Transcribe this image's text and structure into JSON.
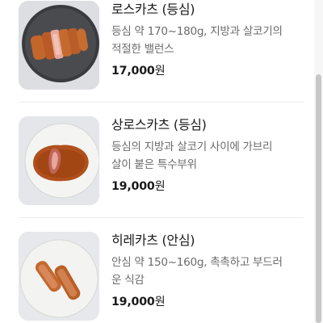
{
  "menu": {
    "items": [
      {
        "name": "로스카츠 (등심)",
        "description_line1": "등심 약 170~180g, 지방과 살코기의",
        "description_line2": "적절한 밸런스",
        "price": "17,000",
        "currency": "원"
      },
      {
        "name": "상로스카츠 (등심)",
        "description_line1": "등심의 지방과 살코기 사이에 가브리",
        "description_line2": "살이 붙은 특수부위",
        "price": "19,000",
        "currency": "원"
      },
      {
        "name": "히레카츠 (안심)",
        "description_line1": "안심 약 150~160g, 촉촉하고 부드러",
        "description_line2": "운 식감",
        "price": "19,000",
        "currency": "원"
      }
    ]
  }
}
